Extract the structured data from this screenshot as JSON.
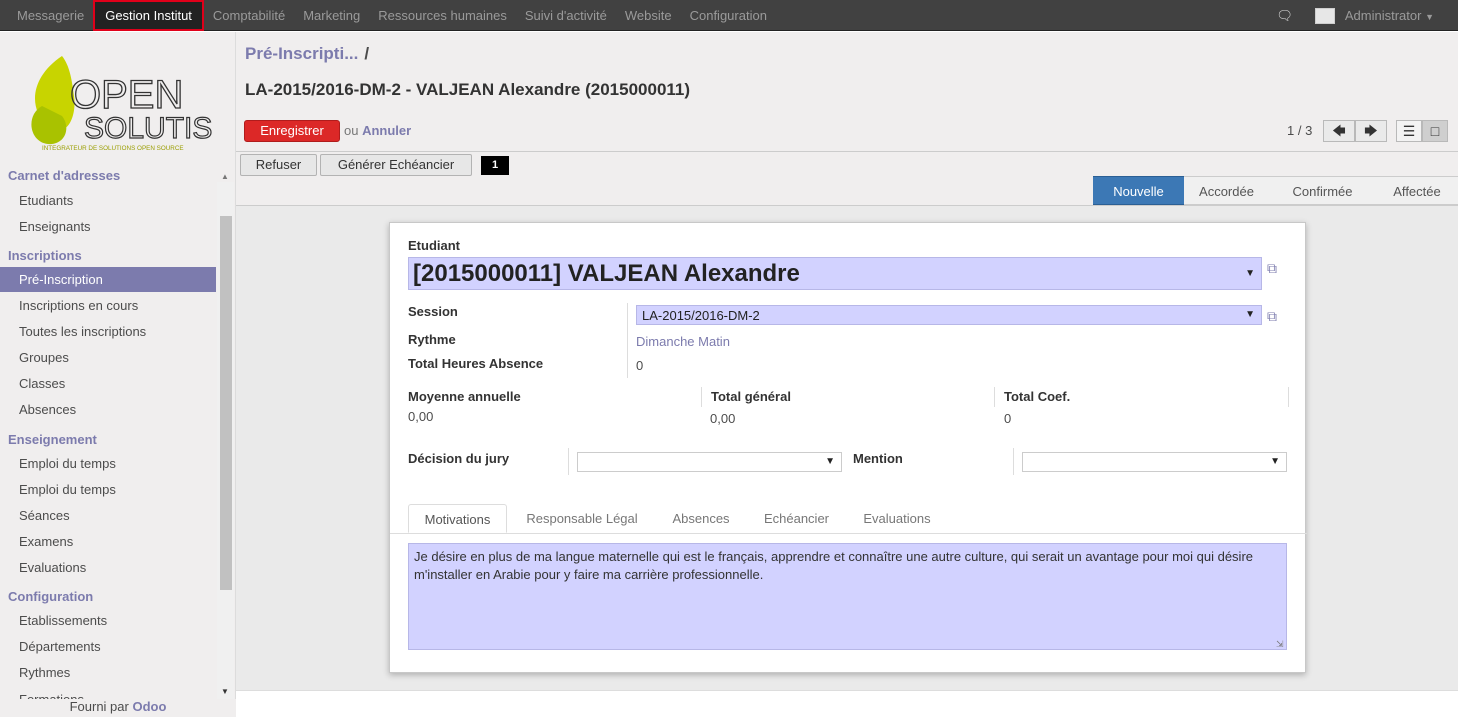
{
  "topbar": {
    "menu": [
      "Messagerie",
      "Gestion Institut",
      "Comptabilité",
      "Marketing",
      "Ressources humaines",
      "Suivi d'activité",
      "Website",
      "Configuration"
    ],
    "user": "Administrator"
  },
  "sidebar": {
    "logo": {
      "line1": "OPEN",
      "line2": "SOLUTIS",
      "tagline": "INTEGRATEUR DE SOLUTIONS OPEN SOURCE"
    },
    "sections": [
      {
        "title": "Carnet d'adresses",
        "items": [
          "Etudiants",
          "Enseignants"
        ]
      },
      {
        "title": "Inscriptions",
        "items": [
          "Pré-Inscription",
          "Inscriptions en cours",
          "Toutes les inscriptions",
          "Groupes",
          "Classes",
          "Absences"
        ]
      },
      {
        "title": "Enseignement",
        "items": [
          "Emploi du temps",
          "Emploi du temps",
          "Séances",
          "Examens",
          "Evaluations"
        ]
      },
      {
        "title": "Configuration",
        "items": [
          "Etablissements",
          "Départements",
          "Rythmes",
          "Formations"
        ]
      }
    ],
    "footer_prefix": "Fourni par",
    "footer_brand": "Odoo"
  },
  "header": {
    "breadcrumb": "Pré-Inscripti...",
    "breadcrumb_sep": "/",
    "record_title": "LA-2015/2016-DM-2 - VALJEAN Alexandre (2015000011)",
    "save_label": "Enregistrer",
    "or_label": "ou",
    "cancel_label": "Annuler",
    "pager": "1 / 3"
  },
  "actions": {
    "refuse": "Refuser",
    "generate": "Générer Echéancier",
    "badge": "1"
  },
  "stages": [
    "Nouvelle",
    "Accordée",
    "Confirmée",
    "Affectée"
  ],
  "form": {
    "student_label": "Etudiant",
    "student_value": "[2015000011] VALJEAN Alexandre",
    "session_label": "Session",
    "session_value": "LA-2015/2016-DM-2",
    "rhythm_label": "Rythme",
    "rhythm_value": "Dimanche Matin",
    "absence_label": "Total Heures Absence",
    "absence_value": "0",
    "avg_label": "Moyenne annuelle",
    "avg_value": "0,00",
    "total_label": "Total général",
    "total_value": "0,00",
    "coef_label": "Total Coef.",
    "coef_value": "0",
    "jury_label": "Décision du jury",
    "mention_label": "Mention"
  },
  "tabs": [
    "Motivations",
    "Responsable Légal",
    "Absences",
    "Echéancier",
    "Evaluations"
  ],
  "motivation_text": "Je désire en plus de ma langue maternelle qui est le français, apprendre et connaître une autre culture, qui serait un avantage pour moi qui désire m'installer en Arabie pour y faire ma carrière professionnelle."
}
